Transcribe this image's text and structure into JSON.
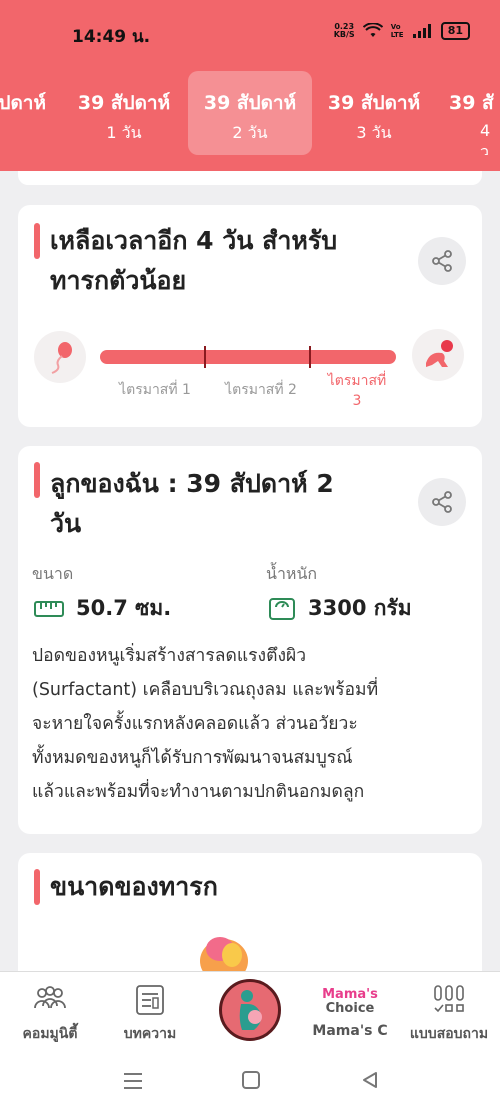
{
  "status_bar": {
    "time": "14:49 น.",
    "net_speed_value": "0.23",
    "net_speed_unit": "KB/S",
    "network_label": "Vo LTE",
    "battery": "81"
  },
  "week_tabs": [
    {
      "week": "ปดาห์",
      "day": ""
    },
    {
      "week": "39 สัปดาห์",
      "day": "1 วัน"
    },
    {
      "week": "39 สัปดาห์",
      "day": "2 วัน"
    },
    {
      "week": "39 สัปดาห์",
      "day": "3 วัน"
    },
    {
      "week": "39 สั",
      "day": "4 ว"
    }
  ],
  "countdown_card": {
    "title_line1": "เหลือเวลาอีก 4 วัน สำหรับ",
    "title_line2": "ทารกตัวน้อย",
    "trimesters": [
      "ไตรมาสที่ 1",
      "ไตรมาสที่ 2",
      "ไตรมาสที่",
      "3"
    ],
    "progress": 1.0
  },
  "baby_card": {
    "title_line1": "ลูกของฉัน : 39 สัปดาห์ 2",
    "title_line2": "วัน",
    "size_label": "ขนาด",
    "size_value": "50.7 ซม.",
    "weight_label": "น้ำหนัก",
    "weight_value": "3300 กรัม",
    "description": [
      "ปอดของหนูเริ่มสร้างสารลดแรงตึงผิว",
      "(Surfactant) เคลือบบริเวณถุงลม และพร้อมที่",
      "จะหายใจครั้งแรกหลังคลอดแล้ว ส่วนอวัยวะ",
      "ทั้งหมดของหนูก็ได้รับการพัฒนาจนสมบูรณ์",
      "แล้วและพร้อมที่จะทำงานตามปกตินอกมดลูก"
    ]
  },
  "size_card": {
    "title": "ขนาดของทารก"
  },
  "bottom_nav": {
    "community": "คอมมูนิตี้",
    "articles": "บทความ",
    "mamas_choice_logo_line1": "Mama's",
    "mamas_choice_logo_line2": "Choice",
    "mamas_choice": "Mama's C",
    "survey": "แบบสอบถาม"
  },
  "colors": {
    "accent": "#f2666b",
    "background": "#efeff1",
    "progress_tick": "#8a1a1f",
    "nav_icon": "#2e8b57"
  }
}
